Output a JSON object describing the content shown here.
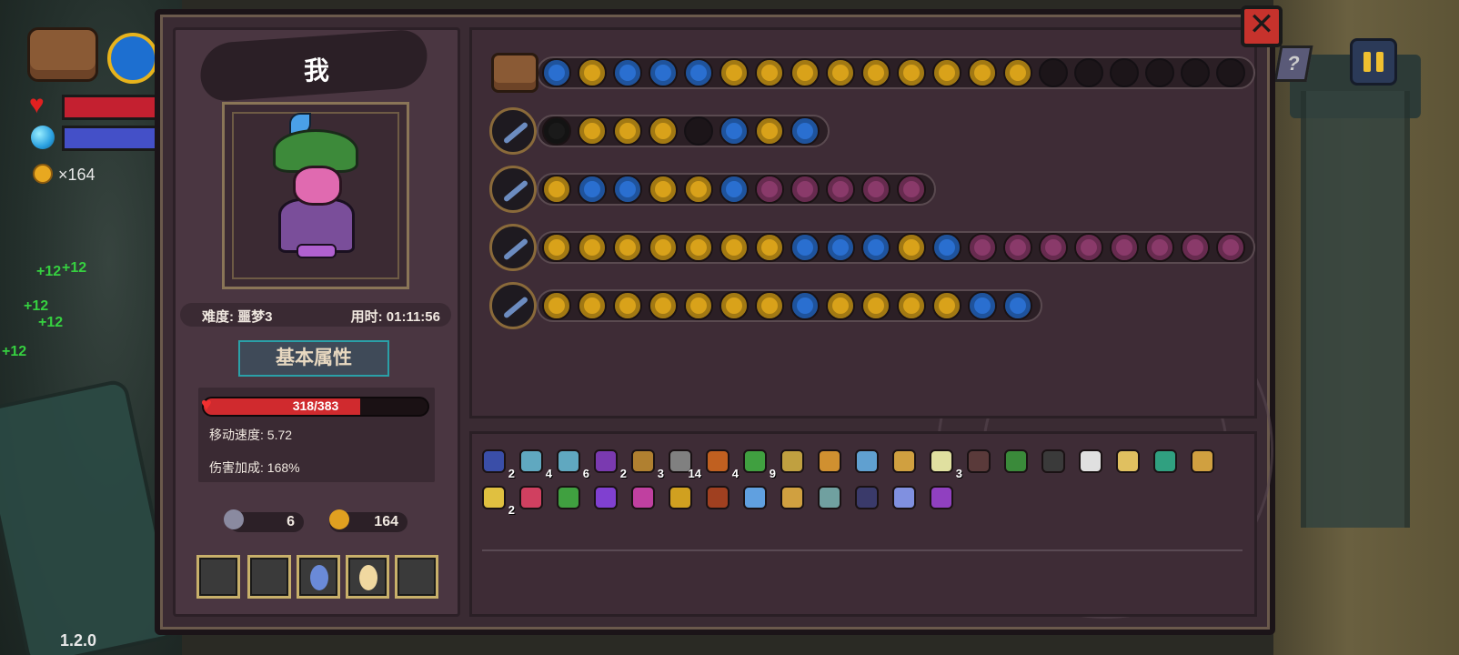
{
  "hud": {
    "coins": "×164",
    "version": "1.2.0",
    "heal_popups": [
      "+12",
      "+12",
      "+12",
      "+12",
      "+12"
    ],
    "help_label": "?"
  },
  "panel": {
    "close_symbol": "✕"
  },
  "profile": {
    "name": "我",
    "difficulty": "难度: 噩梦3",
    "time": "用时: 01:11:56",
    "section_tab": "基本属性",
    "hp_text": "318/383",
    "hp_current": 318,
    "hp_max": 383,
    "move_speed": "移动速度: 5.72",
    "damage_bonus": "伤害加成: 168%",
    "keys": "6",
    "coins": "164"
  },
  "weapon_rows": [
    {
      "head": "backpack-icon",
      "gems": [
        {
          "icon": "slime-icon",
          "color": "#2a6fd0"
        },
        {
          "icon": "arrow-up-icon",
          "color": "#d9a21a"
        },
        {
          "icon": "rainbow-icon",
          "color": "#2a6fd0"
        },
        {
          "icon": "wing-icon",
          "color": "#2a6fd0"
        },
        {
          "icon": "vortex-icon",
          "color": "#2a6fd0"
        },
        {
          "icon": "double-arrow-icon",
          "color": "#d9a21a"
        },
        {
          "icon": "bread-icon",
          "color": "#d9a21a"
        },
        {
          "icon": "fire-icon",
          "color": "#d9a21a"
        },
        {
          "icon": "pause-coin-icon",
          "color": "#d9a21a"
        },
        {
          "icon": "gear-icon",
          "color": "#d9a21a"
        },
        {
          "icon": "rocket-icon",
          "color": "#d9a21a"
        },
        {
          "icon": "rocket-icon",
          "color": "#d9a21a"
        },
        {
          "icon": "tent-icon",
          "color": "#d9a21a"
        },
        {
          "icon": "arrow-up-icon",
          "color": "#d9a21a"
        },
        {
          "icon": "empty",
          "color": ""
        },
        {
          "icon": "empty",
          "color": ""
        },
        {
          "icon": "empty",
          "color": ""
        },
        {
          "icon": "empty",
          "color": ""
        },
        {
          "icon": "empty",
          "color": ""
        },
        {
          "icon": "empty",
          "color": ""
        }
      ]
    },
    {
      "head": "staff-icon",
      "gems": [
        {
          "icon": "bow-icon",
          "color": "#1a1a1a"
        },
        {
          "icon": "triskelion-icon",
          "color": "#d9a21a"
        },
        {
          "icon": "star-burst-icon",
          "color": "#d9a21a"
        },
        {
          "icon": "star-burst-icon",
          "color": "#d9a21a"
        },
        {
          "icon": "empty",
          "color": ""
        },
        {
          "icon": "rainbow-icon",
          "color": "#2a6fd0"
        },
        {
          "icon": "rocket-icon",
          "color": "#d9a21a"
        },
        {
          "icon": "feather-icon",
          "color": "#2a6fd0"
        }
      ]
    },
    {
      "head": "wand-icon",
      "gems": [
        {
          "icon": "ghost-icon",
          "color": "#d9a21a"
        },
        {
          "icon": "eye-icon",
          "color": "#2a6fd0"
        },
        {
          "icon": "butterfly-icon",
          "color": "#2a6fd0"
        },
        {
          "icon": "moon-swirl-icon",
          "color": "#d9a21a"
        },
        {
          "icon": "moon-swirl-icon",
          "color": "#d9a21a"
        },
        {
          "icon": "crescent-icon",
          "color": "#2a6fd0"
        },
        {
          "icon": "petal-icon",
          "color": "#8a3a6a"
        },
        {
          "icon": "petal-icon",
          "color": "#8a3a6a"
        },
        {
          "icon": "petal-icon",
          "color": "#8a3a6a"
        },
        {
          "icon": "petal-icon",
          "color": "#8a3a6a"
        },
        {
          "icon": "petal-icon",
          "color": "#8a3a6a"
        }
      ]
    },
    {
      "head": "spear-icon",
      "gems": [
        {
          "icon": "ghost-icon",
          "color": "#d9a21a"
        },
        {
          "icon": "heart-organ-icon",
          "color": "#d9a21a"
        },
        {
          "icon": "heart-organ-icon",
          "color": "#d9a21a"
        },
        {
          "icon": "jar-icon",
          "color": "#d9a21a"
        },
        {
          "icon": "target-icon",
          "color": "#d9a21a"
        },
        {
          "icon": "orbit-icon",
          "color": "#d9a21a"
        },
        {
          "icon": "triskelion-icon",
          "color": "#d9a21a"
        },
        {
          "icon": "book-icon",
          "color": "#2a6fd0"
        },
        {
          "icon": "book-icon",
          "color": "#2a6fd0"
        },
        {
          "icon": "feather-icon",
          "color": "#2a6fd0"
        },
        {
          "icon": "sun-icon",
          "color": "#d9a21a"
        },
        {
          "icon": "wing-icon",
          "color": "#2a6fd0"
        },
        {
          "icon": "petal-icon",
          "color": "#8a3a6a"
        },
        {
          "icon": "petal-icon",
          "color": "#8a3a6a"
        },
        {
          "icon": "petal-icon",
          "color": "#8a3a6a"
        },
        {
          "icon": "petal-icon",
          "color": "#8a3a6a"
        },
        {
          "icon": "petal-icon",
          "color": "#8a3a6a"
        },
        {
          "icon": "petal-icon",
          "color": "#8a3a6a"
        },
        {
          "icon": "petal-icon",
          "color": "#8a3a6a"
        },
        {
          "icon": "petal-icon",
          "color": "#8a3a6a"
        }
      ]
    },
    {
      "head": "crystal-staff-icon",
      "gems": [
        {
          "icon": "ghost-icon",
          "color": "#d9a21a"
        },
        {
          "icon": "bomb-icon",
          "color": "#d9a21a"
        },
        {
          "icon": "rune-icon",
          "color": "#d9a21a"
        },
        {
          "icon": "rune-icon",
          "color": "#d9a21a"
        },
        {
          "icon": "rune-icon",
          "color": "#d9a21a"
        },
        {
          "icon": "rune-icon",
          "color": "#d9a21a"
        },
        {
          "icon": "cherry-bomb-icon",
          "color": "#d9a21a"
        },
        {
          "icon": "dna-icon",
          "color": "#2a6fd0"
        },
        {
          "icon": "orbit-icon",
          "color": "#d9a21a"
        },
        {
          "icon": "fire-icon",
          "color": "#d9a21a"
        },
        {
          "icon": "cherry-bomb-icon",
          "color": "#d9a21a"
        },
        {
          "icon": "open-book-icon",
          "color": "#d9a21a"
        },
        {
          "icon": "book-icon",
          "color": "#2a6fd0"
        },
        {
          "icon": "slime-icon",
          "color": "#2a6fd0"
        }
      ]
    }
  ],
  "inventory": {
    "row1": [
      {
        "icon": "squid-icon",
        "color": "#3a4ea8",
        "count": "2"
      },
      {
        "icon": "bow-icon",
        "color": "#60a8c0",
        "count": "4"
      },
      {
        "icon": "crossbow-icon",
        "color": "#60a8c0",
        "count": "6"
      },
      {
        "icon": "wizard-hat-icon",
        "color": "#7a3ab0",
        "count": "2"
      },
      {
        "icon": "pickaxe-icon",
        "color": "#b08030",
        "count": "3"
      },
      {
        "icon": "bow-icon",
        "color": "#808080",
        "count": "14"
      },
      {
        "icon": "arrow-icon",
        "color": "#c06020",
        "count": "4"
      },
      {
        "icon": "arrow-icon",
        "color": "#40a040",
        "count": "9"
      },
      {
        "icon": "arrow-plus-icon",
        "color": "#c0a040",
        "count": ""
      },
      {
        "icon": "scroll-icon",
        "color": "#d09030",
        "count": ""
      },
      {
        "icon": "key-icon",
        "color": "#60a0d0",
        "count": ""
      },
      {
        "icon": "leaf-icon",
        "color": "#d0a040",
        "count": ""
      },
      {
        "icon": "claw-icon",
        "color": "#e0e0a0",
        "count": "3"
      },
      {
        "icon": "cloak-icon",
        "color": "#5a3a3a",
        "count": ""
      },
      {
        "icon": "mushroom-icon",
        "color": "#3a8a3a",
        "count": ""
      },
      {
        "icon": "beetle-icon",
        "color": "#3a3a3a",
        "count": ""
      },
      {
        "icon": "glasses-icon",
        "color": "#e0e0e0",
        "count": ""
      },
      {
        "icon": "wrench-icon",
        "color": "#e0c060",
        "count": ""
      },
      {
        "icon": "lotus-icon",
        "color": "#30a080",
        "count": ""
      },
      {
        "icon": "flashlight-icon",
        "color": "#d0a040",
        "count": ""
      }
    ],
    "row2": [
      {
        "icon": "potion-icon",
        "color": "#e0c040",
        "count": "2"
      },
      {
        "icon": "berry-icon",
        "color": "#d04060",
        "count": ""
      },
      {
        "icon": "sword-icon",
        "color": "#40a040",
        "count": ""
      },
      {
        "icon": "rainbow-cape-icon",
        "color": "#8040d0",
        "count": ""
      },
      {
        "icon": "mask-icon",
        "color": "#c040a0",
        "count": ""
      },
      {
        "icon": "gauntlet-icon",
        "color": "#d0a020",
        "count": ""
      },
      {
        "icon": "crate-icon",
        "color": "#a04020",
        "count": ""
      },
      {
        "icon": "magnifier-icon",
        "color": "#60a0e0",
        "count": ""
      },
      {
        "icon": "hourglass-icon",
        "color": "#d0a040",
        "count": ""
      },
      {
        "icon": "globe-icon",
        "color": "#70a0a0",
        "count": ""
      },
      {
        "icon": "robe-icon",
        "color": "#3a3a6a",
        "count": ""
      },
      {
        "icon": "mirror-icon",
        "color": "#8090e0",
        "count": ""
      },
      {
        "icon": "boot-icon",
        "color": "#9040c0",
        "count": ""
      }
    ]
  },
  "colors": {
    "panel_bg": "#3a2b33",
    "hp_red": "#d02a2e",
    "accent_gold": "#c8b06a",
    "accent_teal": "#2aa0a8"
  }
}
